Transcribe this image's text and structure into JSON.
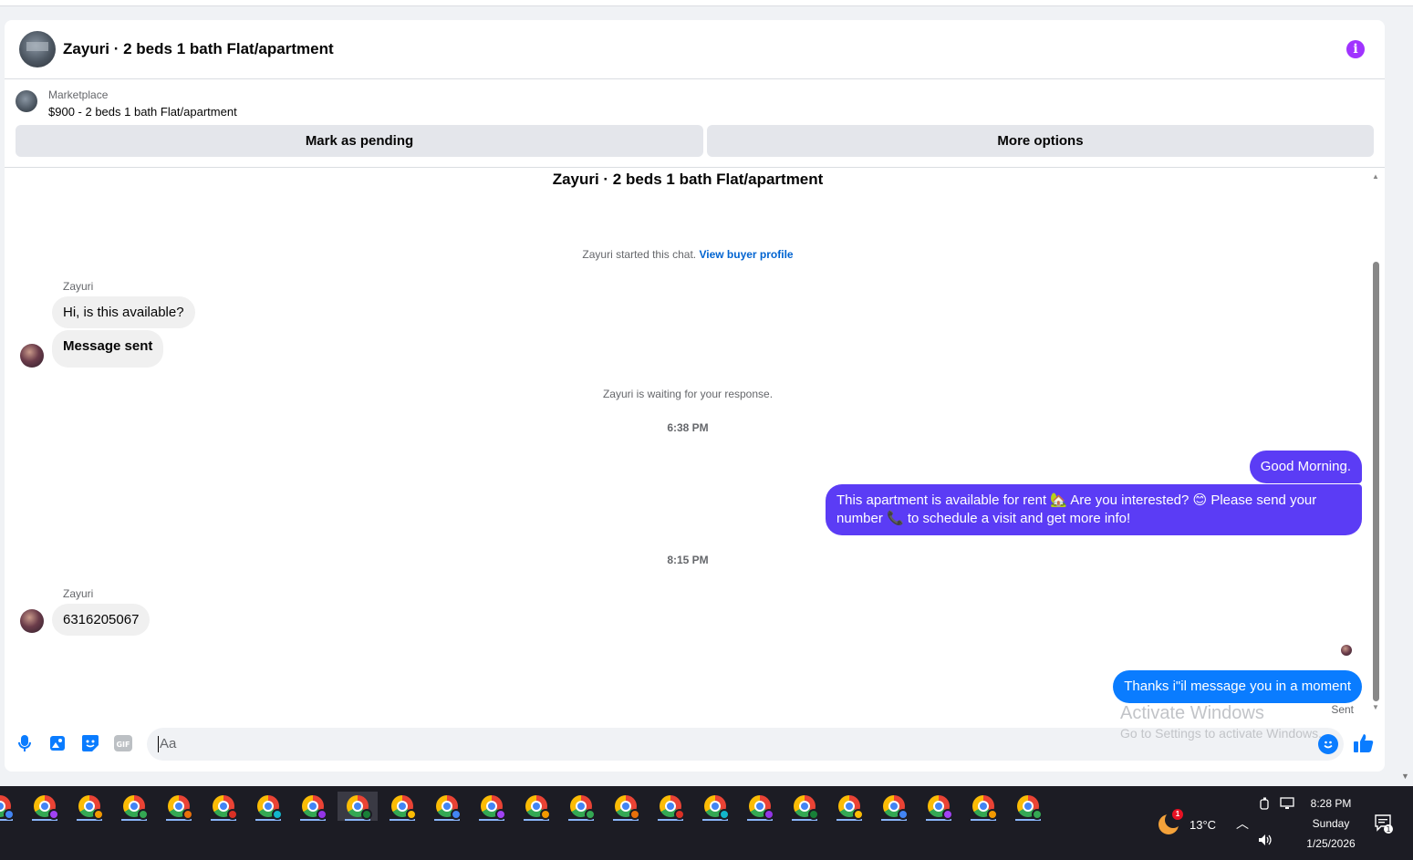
{
  "header": {
    "title": "Zayuri · 2 beds 1 bath Flat/apartment",
    "info_icon": "info-icon"
  },
  "marketplace": {
    "label": "Marketplace",
    "listing": "$900 - 2 beds 1 bath Flat/apartment"
  },
  "actions": {
    "mark_pending": "Mark as pending",
    "more_options": "More options"
  },
  "chat": {
    "title": "Zayuri · 2 beds 1 bath Flat/apartment",
    "started_text": "Zayuri started this chat.",
    "view_profile_link": "View buyer profile",
    "waiting_text": "Zayuri is waiting for your response.",
    "timestamp_1": "6:38 PM",
    "timestamp_2": "8:15 PM",
    "sender_name_1": "Zayuri",
    "sender_name_2": "Zayuri",
    "incoming_1": "Hi, is this available?",
    "incoming_2": "Message sent",
    "outgoing_1": "Good Morning.",
    "outgoing_2": "This apartment is available for rent 🏡 Are you interested? 😊 Please send your number 📞 to schedule a visit and get more info!",
    "incoming_3": "6316205067",
    "outgoing_3": "Thanks i\"il message you in a moment",
    "sent_status": "Sent",
    "outgoing_color_purple": "#5b3cf5",
    "outgoing_color_blue": "#0a7cff"
  },
  "composer": {
    "placeholder": "Aa",
    "tools": [
      "microphone-icon",
      "photo-icon",
      "sticker-icon",
      "gif-icon"
    ],
    "gif_label": "GIF",
    "emoji_icon": "emoji-icon",
    "like_icon": "thumbs-up-icon"
  },
  "watermark": {
    "line1": "Activate Windows",
    "line2": "Go to Settings to activate Windows."
  },
  "taskbar": {
    "app_count": 24,
    "weather_temp": "13°C",
    "weather_badge": "1",
    "time": "8:28 PM",
    "day": "Sunday",
    "date": "1/25/2026",
    "notification_count": "1"
  }
}
